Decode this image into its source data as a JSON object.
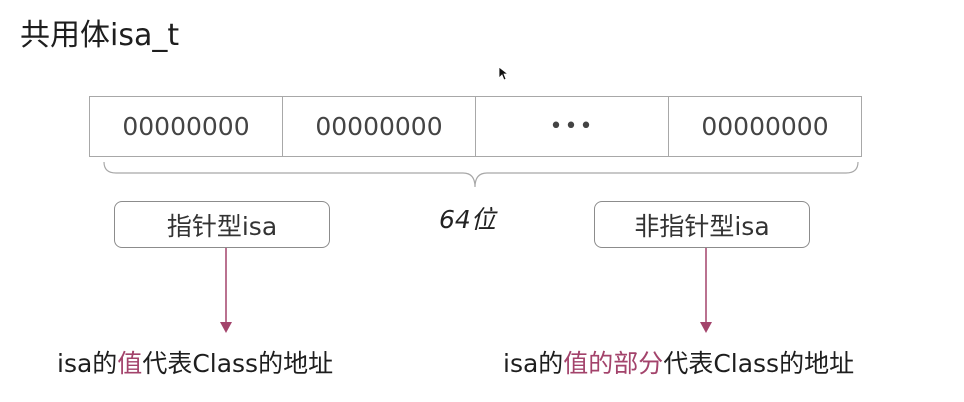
{
  "title": "共用体isa_t",
  "bits": [
    "00000000",
    "00000000",
    "•••",
    "00000000"
  ],
  "bit_count": "64位",
  "left": {
    "tag": "指针型isa",
    "caption_pre": "isa的",
    "caption_hl": "值",
    "caption_post": "代表Class的地址"
  },
  "right": {
    "tag": "非指针型isa",
    "caption_pre": "isa的",
    "caption_hl": "值的部分",
    "caption_post": "代表Class的地址"
  },
  "colors": {
    "highlight": "#a3436b",
    "arrow": "#a3436b",
    "border": "#a8a8a8"
  }
}
